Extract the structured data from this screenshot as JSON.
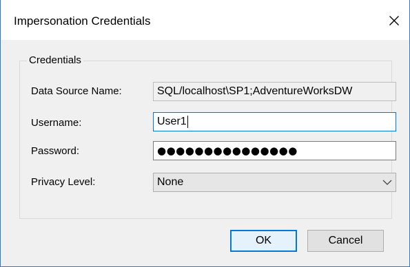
{
  "window": {
    "title": "Impersonation Credentials",
    "title_fragment": "Impersonation Credentials"
  },
  "group": {
    "label": "Credentials"
  },
  "fields": {
    "data_source": {
      "label": "Data Source Name:",
      "value": "SQL/localhost\\SP1;AdventureWorksDW"
    },
    "username": {
      "label": "Username:",
      "value": "User1"
    },
    "password": {
      "label": "Password:",
      "value": "●●●●●●●●●●●●●●●"
    },
    "privacy_level": {
      "label": "Privacy Level:",
      "selected": "None"
    }
  },
  "buttons": {
    "ok_label": "OK",
    "cancel_label": "Cancel"
  },
  "colors": {
    "window_border": "#2b79c7",
    "focus_accent": "#0078d7",
    "dialog_background": "#f0f0f0"
  },
  "icons": {
    "close": "close-icon",
    "dropdown": "chevron-down-icon"
  }
}
